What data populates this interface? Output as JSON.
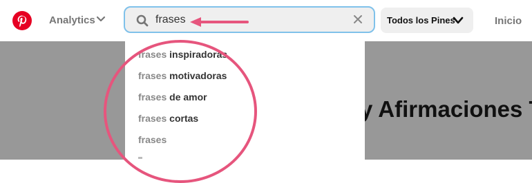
{
  "nav": {
    "logo_icon": "pinterest-logo",
    "analytics_label": "Analytics",
    "scope_label": "Todos los Pines",
    "home_label": "Inicio"
  },
  "search": {
    "value": "frases",
    "icon": "search-icon",
    "clear_icon": "close-icon"
  },
  "suggestions": [
    {
      "query": "frases",
      "rest": " inspiradoras"
    },
    {
      "query": "frases",
      "rest": " motivadoras"
    },
    {
      "query": "frases",
      "rest": " de amor"
    },
    {
      "query": "frases",
      "rest": " cortas"
    },
    {
      "query": "frases",
      "rest": ""
    }
  ],
  "banner": {
    "title": "y Afirmaciones T"
  },
  "colors": {
    "brand": "#e60023",
    "highlight": "#e6557d",
    "focus_border": "#7fc1ea",
    "banner_bg": "#989898"
  }
}
